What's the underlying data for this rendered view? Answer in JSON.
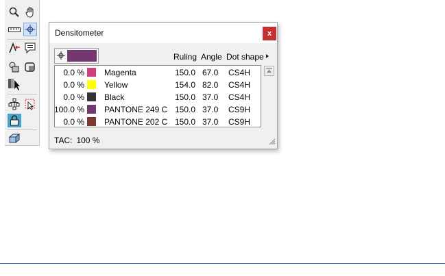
{
  "window": {
    "title": "Densitometer",
    "close_label": "x",
    "columns": {
      "ruling": "Ruling",
      "angle": "Angle",
      "dot_shape": "Dot shape"
    },
    "current_color": "#73386f",
    "inks": [
      {
        "percent": "0.0 %",
        "color": "#d0407e",
        "name": "Magenta",
        "ruling": "150.0",
        "angle": "67.0",
        "dot_shape": "CS4H"
      },
      {
        "percent": "0.0 %",
        "color": "#ffff00",
        "name": "Yellow",
        "ruling": "154.0",
        "angle": "82.0",
        "dot_shape": "CS4H"
      },
      {
        "percent": "0.0 %",
        "color": "#333333",
        "name": "Black",
        "ruling": "150.0",
        "angle": "37.0",
        "dot_shape": "CS4H"
      },
      {
        "percent": "100.0 %",
        "color": "#73386f",
        "name": "PANTONE 249 C",
        "ruling": "150.0",
        "angle": "37.0",
        "dot_shape": "CS9H"
      },
      {
        "percent": "0.0 %",
        "color": "#7a3a32",
        "name": "PANTONE 202 C",
        "ruling": "150.0",
        "angle": "37.0",
        "dot_shape": "CS9H"
      }
    ],
    "tac": {
      "label": "TAC:",
      "value": "100 %"
    }
  },
  "toolbar": {
    "tools": [
      {
        "name": "zoom-icon"
      },
      {
        "name": "hand-icon"
      },
      {
        "name": "ruler-icon"
      },
      {
        "name": "densitometer-icon",
        "active": true
      },
      {
        "name": "pen-arrow-icon"
      },
      {
        "name": "comment-icon"
      },
      {
        "name": "shapes-icon"
      },
      {
        "name": "rounded-rect-icon"
      },
      {
        "name": "separation-arrow-icon"
      },
      {
        "name": "tree-icon"
      },
      {
        "name": "select-shape-icon"
      },
      {
        "name": "lock-icon"
      },
      {
        "name": "3d-box-icon"
      }
    ]
  },
  "colors": {
    "accent": "#c63030",
    "selection": "#cfe0f7",
    "bottom_line": "#1f3f9f"
  }
}
